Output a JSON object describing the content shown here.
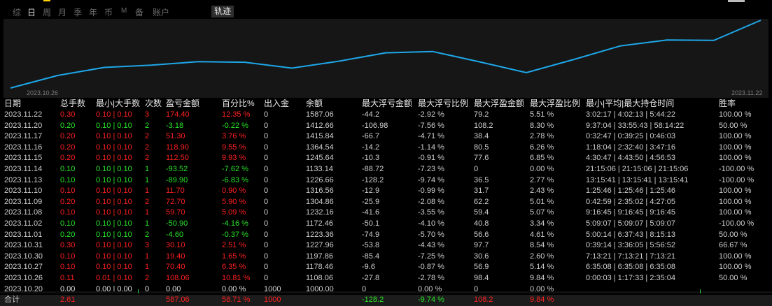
{
  "tabs": [
    {
      "label": "综",
      "active": false
    },
    {
      "label": "日",
      "active": true
    },
    {
      "label": "周",
      "active": false
    },
    {
      "label": "月",
      "active": false
    },
    {
      "label": "季",
      "active": false
    },
    {
      "label": "年",
      "active": false
    },
    {
      "label": "币",
      "active": false
    },
    {
      "label": "M",
      "active": false
    },
    {
      "label": "备",
      "active": false
    },
    {
      "label": "账户",
      "active": false
    }
  ],
  "track_tab": "轨迹",
  "chart": {
    "start_date": "2023.10.26",
    "end_date": "2023.11.22",
    "line_color": "#1ea7e8",
    "balance_series": [
      1000.0,
      1108.06,
      1178.46,
      1197.86,
      1227.96,
      1223.36,
      1172.46,
      1232.16,
      1304.86,
      1316.56,
      1226.66,
      1133.14,
      1245.64,
      1364.54,
      1415.84,
      1412.66,
      1587.06
    ]
  },
  "headers": [
    "日期",
    "总手数",
    "最小|大手数",
    "次数",
    "盈亏金额",
    "百分比%",
    "出入金",
    "余额",
    "最大浮亏金额",
    "最大浮亏比例",
    "最大浮盈金额",
    "最大浮盈比例",
    "最小|平均|最大持仓时间",
    "胜率"
  ],
  "rows": [
    {
      "date": "2023.11.22",
      "lots": "0.30",
      "minmax": "0.10 | 0.10",
      "count": "3",
      "pl": "174.40",
      "pct": "12.35 %",
      "io": "0",
      "bal": "1587.06",
      "ddamt": "-44.2",
      "ddpct": "-2.92 %",
      "fpamt": "79.2",
      "fppct": "5.51 %",
      "time": "3:02:17 | 4:02:13 | 5:44:22",
      "win": "100.00 %",
      "color": "red"
    },
    {
      "date": "2023.11.20",
      "lots": "0.20",
      "minmax": "0.10 | 0.10",
      "count": "2",
      "pl": "-3.18",
      "pct": "-0.22 %",
      "io": "0",
      "bal": "1412.66",
      "ddamt": "-106.98",
      "ddpct": "-7.56 %",
      "fpamt": "108.2",
      "fppct": "8.30 %",
      "time": "9:37:04 | 33:55:43 | 58:14:22",
      "win": "50.00 %",
      "color": "green"
    },
    {
      "date": "2023.11.17",
      "lots": "0.20",
      "minmax": "0.10 | 0.10",
      "count": "2",
      "pl": "51.30",
      "pct": "3.76 %",
      "io": "0",
      "bal": "1415.84",
      "ddamt": "-66.7",
      "ddpct": "-4.71 %",
      "fpamt": "38.4",
      "fppct": "2.78 %",
      "time": "0:32:47 | 0:39:25 | 0:46:03",
      "win": "100.00 %",
      "color": "red"
    },
    {
      "date": "2023.11.16",
      "lots": "0.20",
      "minmax": "0.10 | 0.10",
      "count": "2",
      "pl": "118.90",
      "pct": "9.55 %",
      "io": "0",
      "bal": "1364.54",
      "ddamt": "-14.2",
      "ddpct": "-1.14 %",
      "fpamt": "80.5",
      "fppct": "6.26 %",
      "time": "1:18:04 | 2:32:40 | 3:47:16",
      "win": "100.00 %",
      "color": "red"
    },
    {
      "date": "2023.11.15",
      "lots": "0.20",
      "minmax": "0.10 | 0.10",
      "count": "2",
      "pl": "112.50",
      "pct": "9.93 %",
      "io": "0",
      "bal": "1245.64",
      "ddamt": "-10.3",
      "ddpct": "-0.91 %",
      "fpamt": "77.6",
      "fppct": "6.85 %",
      "time": "4:30:47 | 4:43:50 | 4:56:53",
      "win": "100.00 %",
      "color": "red"
    },
    {
      "date": "2023.11.14",
      "lots": "0.10",
      "minmax": "0.10 | 0.10",
      "count": "1",
      "pl": "-93.52",
      "pct": "-7.62 %",
      "io": "0",
      "bal": "1133.14",
      "ddamt": "-88.72",
      "ddpct": "-7.23 %",
      "fpamt": "0",
      "fppct": "0.00 %",
      "time": "21:15:06 | 21:15:06 | 21:15:06",
      "win": "-100.00 %",
      "color": "green"
    },
    {
      "date": "2023.11.13",
      "lots": "0.10",
      "minmax": "0.10 | 0.10",
      "count": "1",
      "pl": "-89.90",
      "pct": "-6.83 %",
      "io": "0",
      "bal": "1226.66",
      "ddamt": "-128.2",
      "ddpct": "-9.74 %",
      "fpamt": "36.5",
      "fppct": "2.77 %",
      "time": "13:15:41 | 13:15:41 | 13:15:41",
      "win": "-100.00 %",
      "color": "green"
    },
    {
      "date": "2023.11.10",
      "lots": "0.10",
      "minmax": "0.10 | 0.10",
      "count": "1",
      "pl": "11.70",
      "pct": "0.90 %",
      "io": "0",
      "bal": "1316.56",
      "ddamt": "-12.9",
      "ddpct": "-0.99 %",
      "fpamt": "31.7",
      "fppct": "2.43 %",
      "time": "1:25:46 | 1:25:46 | 1:25:46",
      "win": "100.00 %",
      "color": "red"
    },
    {
      "date": "2023.11.09",
      "lots": "0.20",
      "minmax": "0.10 | 0.10",
      "count": "2",
      "pl": "72.70",
      "pct": "5.90 %",
      "io": "0",
      "bal": "1304.86",
      "ddamt": "-25.9",
      "ddpct": "-2.08 %",
      "fpamt": "62.2",
      "fppct": "5.01 %",
      "time": "0:42:59 | 2:35:02 | 4:27:05",
      "win": "100.00 %",
      "color": "red"
    },
    {
      "date": "2023.11.08",
      "lots": "0.10",
      "minmax": "0.10 | 0.10",
      "count": "1",
      "pl": "59.70",
      "pct": "5.09 %",
      "io": "0",
      "bal": "1232.16",
      "ddamt": "-41.6",
      "ddpct": "-3.55 %",
      "fpamt": "59.4",
      "fppct": "5.07 %",
      "time": "9:16:45 | 9:16:45 | 9:16:45",
      "win": "100.00 %",
      "color": "red"
    },
    {
      "date": "2023.11.02",
      "lots": "0.10",
      "minmax": "0.10 | 0.10",
      "count": "1",
      "pl": "-50.90",
      "pct": "-4.16 %",
      "io": "0",
      "bal": "1172.46",
      "ddamt": "-50.1",
      "ddpct": "-4.10 %",
      "fpamt": "40.8",
      "fppct": "3.34 %",
      "time": "5:09:07 | 5:09:07 | 5:09:07",
      "win": "-100.00 %",
      "color": "green"
    },
    {
      "date": "2023.11.01",
      "lots": "0.20",
      "minmax": "0.10 | 0.10",
      "count": "2",
      "pl": "-4.60",
      "pct": "-0.37 %",
      "io": "0",
      "bal": "1223.36",
      "ddamt": "-74.9",
      "ddpct": "-5.70 %",
      "fpamt": "56.6",
      "fppct": "4.61 %",
      "time": "5:00:14 | 6:37:43 | 8:15:13",
      "win": "50.00 %",
      "color": "green"
    },
    {
      "date": "2023.10.31",
      "lots": "0.30",
      "minmax": "0.10 | 0.10",
      "count": "3",
      "pl": "30.10",
      "pct": "2.51 %",
      "io": "0",
      "bal": "1227.96",
      "ddamt": "-53.8",
      "ddpct": "-4.43 %",
      "fpamt": "97.7",
      "fppct": "8.54 %",
      "time": "0:39:14 | 3:36:05 | 5:56:52",
      "win": "66.67 %",
      "color": "red"
    },
    {
      "date": "2023.10.30",
      "lots": "0.10",
      "minmax": "0.10 | 0.10",
      "count": "1",
      "pl": "19.40",
      "pct": "1.65 %",
      "io": "0",
      "bal": "1197.86",
      "ddamt": "-85.4",
      "ddpct": "-7.25 %",
      "fpamt": "30.6",
      "fppct": "2.60 %",
      "time": "7:13:21 | 7:13:21 | 7:13:21",
      "win": "100.00 %",
      "color": "red"
    },
    {
      "date": "2023.10.27",
      "lots": "0.10",
      "minmax": "0.10 | 0.10",
      "count": "1",
      "pl": "70.40",
      "pct": "6.35 %",
      "io": "0",
      "bal": "1178.46",
      "ddamt": "-9.6",
      "ddpct": "-0.87 %",
      "fpamt": "56.9",
      "fppct": "5.14 %",
      "time": "6:35:08 | 6:35:08 | 6:35:08",
      "win": "100.00 %",
      "color": "red"
    },
    {
      "date": "2023.10.26",
      "lots": "0.11",
      "minmax": "0.01 | 0.10",
      "count": "2",
      "pl": "108.06",
      "pct": "10.81 %",
      "io": "0",
      "bal": "1108.06",
      "ddamt": "-27.8",
      "ddpct": "-2.78 %",
      "fpamt": "98.4",
      "fppct": "9.84 %",
      "time": "0:00:03 | 1:17:33 | 2:35:04",
      "win": "50.00 %",
      "color": "red"
    },
    {
      "date": "2023.10.20",
      "lots": "0.00",
      "minmax": "0.00 | 0.00",
      "count": "0",
      "pl": "0.00",
      "pct": "0.00 %",
      "io": "1000",
      "bal": "1000.00",
      "ddamt": "0",
      "ddpct": "0.00 %",
      "fpamt": "0",
      "fppct": "0.00 %",
      "time": "",
      "win": "",
      "color": "white"
    }
  ],
  "total": {
    "label": "合计",
    "lots": "2.61",
    "pl": "587.06",
    "pct": "58.71 %",
    "io": "1000",
    "ddamt": "-128.2",
    "ddpct": "-9.74 %",
    "fpamt": "108.2",
    "fppct": "9.84 %"
  }
}
